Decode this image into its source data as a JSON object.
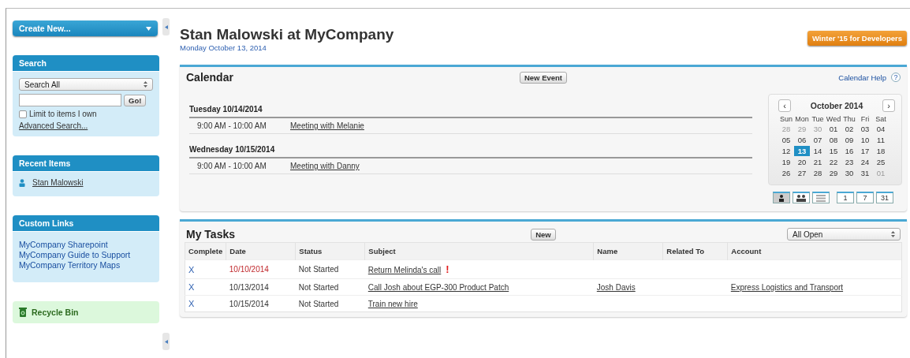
{
  "sidebar": {
    "create_new": "Create New...",
    "search": {
      "title": "Search",
      "scope": "Search All",
      "go": "Go!",
      "limit": {
        "label": "Limit to items I own",
        "checked": false
      },
      "advanced": "Advanced Search..."
    },
    "recent_items": {
      "title": "Recent Items",
      "items": [
        "Stan Malowski"
      ]
    },
    "custom_links": {
      "title": "Custom Links",
      "items": [
        "MyCompany Sharepoint",
        "MyCompany Guide to Support",
        "MyCompany Territory Maps"
      ]
    },
    "recycle_bin": "Recycle Bin"
  },
  "header": {
    "title": "Stan Malowski at MyCompany",
    "date": "Monday October 13, 2014",
    "promo": "Winter '15 for Developers"
  },
  "calendar": {
    "title": "Calendar",
    "new_event": "New Event",
    "help": "Calendar Help",
    "help_icon": "?",
    "days": [
      {
        "label": "Tuesday 10/14/2014",
        "events": [
          {
            "time": "9:00 AM - 10:00 AM",
            "subject": "Meeting with Melanie"
          }
        ]
      },
      {
        "label": "Wednesday 10/15/2014",
        "events": [
          {
            "time": "9:00 AM - 10:00 AM",
            "subject": "Meeting with Danny"
          }
        ]
      }
    ],
    "mini": {
      "month": "October 2014",
      "prev": "‹",
      "next": "›",
      "weekdays": [
        "Sun",
        "Mon",
        "Tue",
        "Wed",
        "Thu",
        "Fri",
        "Sat"
      ],
      "dates": [
        {
          "d": "28",
          "other": true,
          "selected": false
        },
        {
          "d": "29",
          "other": true,
          "selected": false
        },
        {
          "d": "30",
          "other": true,
          "selected": false
        },
        {
          "d": "01",
          "other": false,
          "selected": false
        },
        {
          "d": "02",
          "other": false,
          "selected": false
        },
        {
          "d": "03",
          "other": false,
          "selected": false
        },
        {
          "d": "04",
          "other": false,
          "selected": false
        },
        {
          "d": "05",
          "other": false,
          "selected": false
        },
        {
          "d": "06",
          "other": false,
          "selected": false
        },
        {
          "d": "07",
          "other": false,
          "selected": false
        },
        {
          "d": "08",
          "other": false,
          "selected": false
        },
        {
          "d": "09",
          "other": false,
          "selected": false
        },
        {
          "d": "10",
          "other": false,
          "selected": false
        },
        {
          "d": "11",
          "other": false,
          "selected": false
        },
        {
          "d": "12",
          "other": false,
          "selected": false
        },
        {
          "d": "13",
          "other": false,
          "selected": true
        },
        {
          "d": "14",
          "other": false,
          "selected": false
        },
        {
          "d": "15",
          "other": false,
          "selected": false
        },
        {
          "d": "16",
          "other": false,
          "selected": false
        },
        {
          "d": "17",
          "other": false,
          "selected": false
        },
        {
          "d": "18",
          "other": false,
          "selected": false
        },
        {
          "d": "19",
          "other": false,
          "selected": false
        },
        {
          "d": "20",
          "other": false,
          "selected": false
        },
        {
          "d": "21",
          "other": false,
          "selected": false
        },
        {
          "d": "22",
          "other": false,
          "selected": false
        },
        {
          "d": "23",
          "other": false,
          "selected": false
        },
        {
          "d": "24",
          "other": false,
          "selected": false
        },
        {
          "d": "25",
          "other": false,
          "selected": false
        },
        {
          "d": "26",
          "other": false,
          "selected": false
        },
        {
          "d": "27",
          "other": false,
          "selected": false
        },
        {
          "d": "28",
          "other": false,
          "selected": false
        },
        {
          "d": "29",
          "other": false,
          "selected": false
        },
        {
          "d": "30",
          "other": false,
          "selected": false
        },
        {
          "d": "31",
          "other": false,
          "selected": false
        },
        {
          "d": "01",
          "other": true,
          "selected": false
        }
      ]
    },
    "views": [
      {
        "kind": "single",
        "selected": true
      },
      {
        "kind": "multi",
        "selected": false
      },
      {
        "kind": "list",
        "selected": false
      },
      {
        "kind": "text",
        "label": "1",
        "selected": false
      },
      {
        "kind": "text",
        "label": "7",
        "selected": false
      },
      {
        "kind": "text",
        "label": "31",
        "selected": false
      }
    ]
  },
  "tasks": {
    "title": "My Tasks",
    "new": "New",
    "filter": "All Open",
    "columns": [
      "Complete",
      "Date",
      "Status",
      "Subject",
      "Name",
      "Related To",
      "Account"
    ],
    "rows": [
      {
        "complete": "X",
        "date": "10/10/2014",
        "overdue": true,
        "status": "Not Started",
        "subject": "Return Melinda's call",
        "flag": "!"
      },
      {
        "complete": "X",
        "date": "10/13/2014",
        "overdue": false,
        "status": "Not Started",
        "subject": "Call Josh about EGP-300 Product Patch",
        "name": "Josh Davis",
        "account": "Express Logistics and Transport"
      },
      {
        "complete": "X",
        "date": "10/15/2014",
        "overdue": false,
        "status": "Not Started",
        "subject": "Train new hire"
      }
    ]
  }
}
